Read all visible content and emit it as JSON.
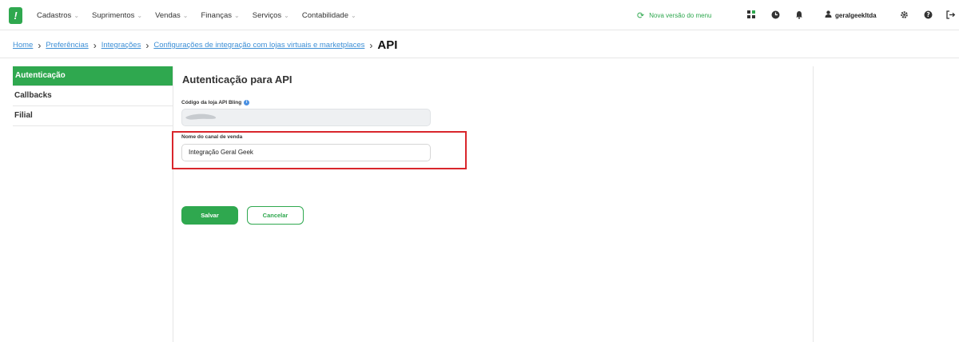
{
  "topbar": {
    "logo": "!",
    "menu": [
      {
        "label": "Cadastros"
      },
      {
        "label": "Suprimentos"
      },
      {
        "label": "Vendas"
      },
      {
        "label": "Finanças"
      },
      {
        "label": "Serviços"
      },
      {
        "label": "Contabilidade"
      }
    ],
    "new_menu_label": "Nova versão do menu",
    "username": "geralgeekltda",
    "accent_color": "#2fa84f"
  },
  "breadcrumb": {
    "items": [
      "Home",
      "Preferências",
      "Integrações",
      "Configurações de integração com lojas virtuais e marketplaces"
    ],
    "current": "API"
  },
  "sidebar": {
    "items": [
      {
        "label": "Autenticação",
        "active": true
      },
      {
        "label": "Callbacks",
        "active": false
      },
      {
        "label": "Filial",
        "active": false
      }
    ]
  },
  "main": {
    "title": "Autenticação para API",
    "store_code_label": "Código da loja API Bling",
    "store_code_value": "",
    "channel_name_label": "Nome do canal de venda",
    "channel_name_value": "Integração Geral Geek",
    "save_label": "Salvar",
    "cancel_label": "Cancelar"
  },
  "highlight_color": "#d9262c"
}
